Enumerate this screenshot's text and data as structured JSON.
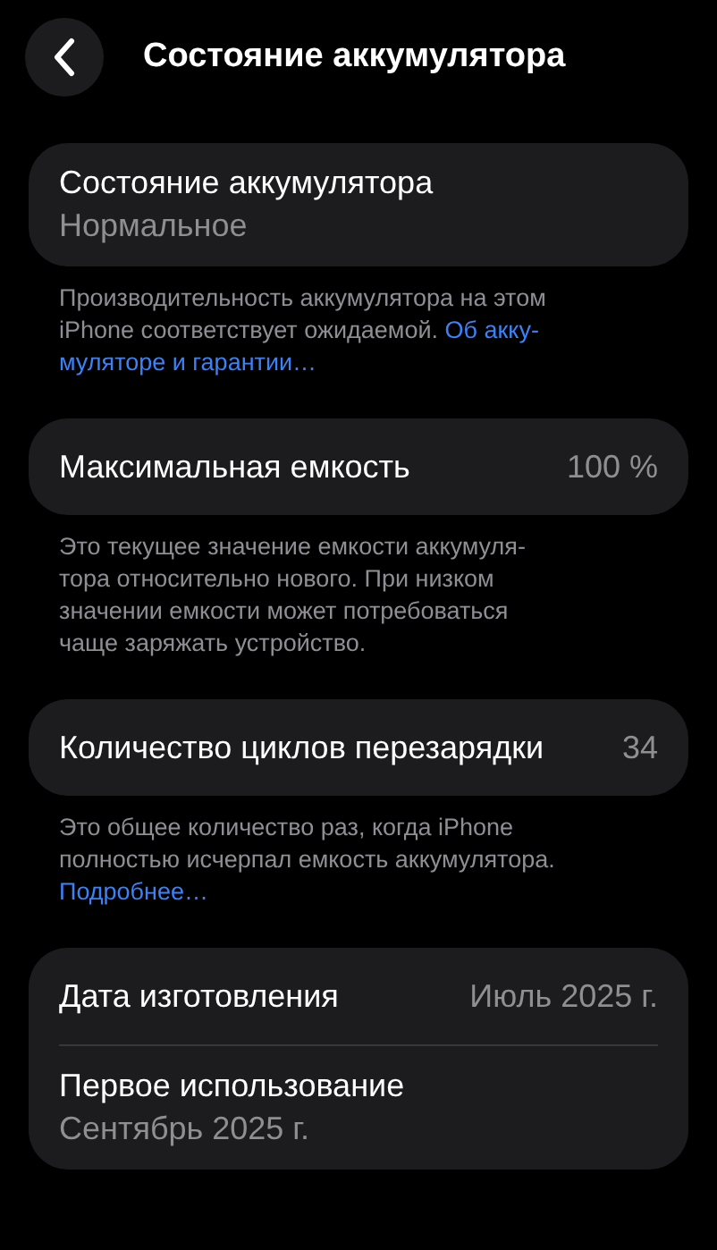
{
  "header": {
    "title": "Состояние аккумулятора"
  },
  "sections": [
    {
      "rows": [
        {
          "kind": "stacked",
          "label": "Состояние аккумулятора",
          "value": "Нормальное"
        }
      ],
      "footer": [
        {
          "text": "Производительность аккумулятора на этом"
        },
        {
          "text": "iPhone соответствует ожидаемой. ",
          "link": "Об акку-"
        },
        {
          "link": "муляторе и гарантии…"
        }
      ]
    },
    {
      "rows": [
        {
          "kind": "inline",
          "label": "Максимальная емкость",
          "value": "100 %"
        }
      ],
      "footer": [
        {
          "text": "Это текущее значение емкости аккумуля-"
        },
        {
          "text": "тора относительно нового. При низком"
        },
        {
          "text": "значении емкости может потребоваться"
        },
        {
          "text": "чаще заряжать устройство."
        }
      ]
    },
    {
      "rows": [
        {
          "kind": "inline",
          "label": "Количество циклов перезарядки",
          "value": "34"
        }
      ],
      "footer": [
        {
          "text": "Это общее количество раз, когда iPhone"
        },
        {
          "text": "полностью исчерпал емкость аккумулятора."
        },
        {
          "link": "Подробнее…"
        }
      ]
    },
    {
      "rows": [
        {
          "kind": "inline",
          "label": "Дата изготовления",
          "value": "Июль 2025 г."
        },
        {
          "kind": "stacked",
          "label": "Первое использование",
          "value": "Сентябрь 2025 г."
        }
      ]
    }
  ]
}
